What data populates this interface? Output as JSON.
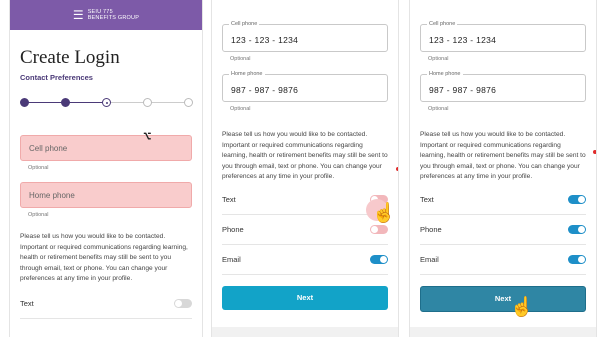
{
  "brand": {
    "logo_line1": "SEIU 775",
    "logo_line2": "BENEFITS GROUP"
  },
  "screen1": {
    "title": "Create Login",
    "subtitle": "Contact Preferences",
    "cell_phone_placeholder": "Cell phone",
    "home_phone_placeholder": "Home phone",
    "optional": "Optional",
    "paragraph": "Please tell us how you would like to be contacted. Important or required communications regarding learning, health or retirement benefits may still be sent to you through email, text or phone. You can change your preferences at any time in your profile.",
    "option_text": "Text"
  },
  "screen2": {
    "cell_label": "Cell phone",
    "cell_value": "123 - 123 - 1234",
    "home_label": "Home phone",
    "home_value": "987 - 987 - 9876",
    "optional": "Optional",
    "paragraph": "Please tell us how you would like to be contacted. Important or required communications regarding learning, health or retirement benefits may still be sent to you through email, text or phone. You can change your preferences at any time in your profile.",
    "options": [
      {
        "label": "Text"
      },
      {
        "label": "Phone"
      },
      {
        "label": "Email"
      }
    ],
    "next_label": "Next"
  },
  "screen3": {
    "cell_label": "Cell phone",
    "cell_value": "123 - 123 - 1234",
    "home_label": "Home phone",
    "home_value": "987 - 987 - 9876",
    "optional": "Optional",
    "paragraph": "Please tell us how you would like to be contacted. Important or required communications regarding learning, health or retirement benefits may still be sent to you through email, text or phone. You can change your preferences at any time in your profile.",
    "options": [
      {
        "label": "Text"
      },
      {
        "label": "Phone"
      },
      {
        "label": "Email"
      }
    ],
    "next_label": "Next"
  },
  "colors": {
    "brand_purple": "#7d5aa8",
    "toggle_on": "#1e8fc8",
    "button_blue": "#12a3c8",
    "highlight_pink": "#f9cccc"
  },
  "icons": {
    "cursor_ibeam": "text-cursor-icon",
    "tap_hand": "pointer-hand-icon"
  }
}
